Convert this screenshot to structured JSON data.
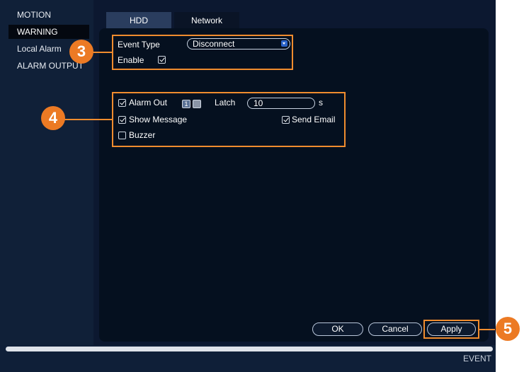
{
  "sidebar": {
    "items": [
      {
        "label": "MOTION"
      },
      {
        "label": "WARNING"
      },
      {
        "label": "Local Alarm"
      },
      {
        "label": "ALARM OUTPUT"
      }
    ]
  },
  "tabs": [
    {
      "label": "HDD"
    },
    {
      "label": "Network"
    }
  ],
  "form": {
    "event_type_label": "Event Type",
    "event_type_value": "Disconnect",
    "enable_label": "Enable",
    "enable_checked": true,
    "alarm_out_label": "Alarm Out",
    "alarm_out_checked": true,
    "alarm_channels": [
      "1",
      ""
    ],
    "latch_label": "Latch",
    "latch_value": "10",
    "latch_unit": "s",
    "show_message_label": "Show Message",
    "show_message_checked": true,
    "send_email_label": "Send Email",
    "send_email_checked": true,
    "buzzer_label": "Buzzer",
    "buzzer_checked": false
  },
  "buttons": {
    "ok": "OK",
    "cancel": "Cancel",
    "apply": "Apply"
  },
  "callouts": [
    "3",
    "4",
    "5"
  ],
  "footer": {
    "label": "EVENT"
  },
  "colors": {
    "highlight": "#f08c2e",
    "callout": "#ec7a24",
    "panel": "#05101f",
    "background": "#0c1830"
  }
}
